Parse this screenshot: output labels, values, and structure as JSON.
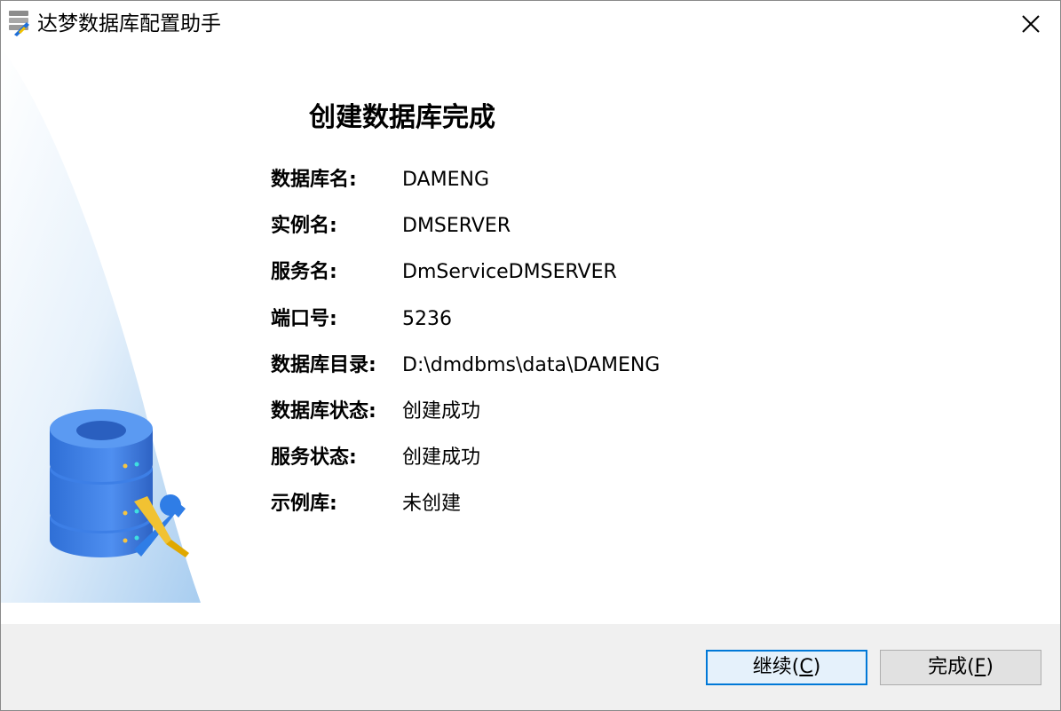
{
  "window": {
    "title": "达梦数据库配置助手"
  },
  "page": {
    "title": "创建数据库完成"
  },
  "info": [
    {
      "label": "数据库名:",
      "value": "DAMENG"
    },
    {
      "label": "实例名:",
      "value": "DMSERVER"
    },
    {
      "label": "服务名:",
      "value": "DmServiceDMSERVER"
    },
    {
      "label": "端口号:",
      "value": "5236"
    },
    {
      "label": "数据库目录:",
      "value": "D:\\dmdbms\\data\\DAMENG"
    },
    {
      "label": "数据库状态:",
      "value": "创建成功"
    },
    {
      "label": "服务状态:",
      "value": "创建成功"
    },
    {
      "label": "示例库:",
      "value": "未创建"
    }
  ],
  "buttons": {
    "continue_label": "继续(",
    "continue_key": "C",
    "continue_end": ")",
    "finish_label": "完成(",
    "finish_key": "F",
    "finish_end": ")"
  },
  "icons": {
    "app": "database-tool-icon",
    "close": "close-icon",
    "illustration": "database-wrench-icon"
  },
  "colors": {
    "accent": "#0078d7",
    "database_blue": "#3b82e8",
    "background_panel": "#f0f0f0"
  }
}
